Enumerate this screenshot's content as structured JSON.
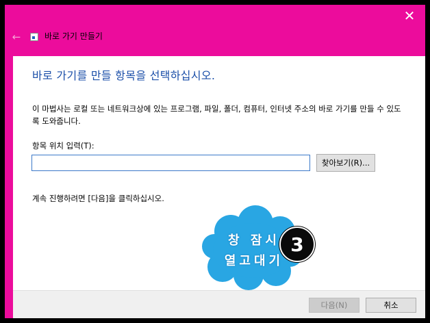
{
  "window": {
    "title": "바로 가기 만들기",
    "accent_color": "#ec0c9c",
    "close_glyph": "✕",
    "back_glyph": "←",
    "icons": {
      "close": "close-icon",
      "back": "back-arrow-icon",
      "app": "shortcut-icon"
    }
  },
  "wizard": {
    "heading": "바로 가기를 만들 항목을 선택하십시오.",
    "description": "이 마법사는 로컬 또는 네트워크상에 있는 프로그램, 파일, 폴더, 컴퓨터, 인터넷 주소의 바로 가기를 만들 수 있도록 도와줍니다.",
    "location_label": "항목 위치 입력(T):",
    "location_value": "",
    "browse_label": "찾아보기(R)...",
    "continue_text": "계속 진행하려면 [다음]을 클릭하십시오."
  },
  "footer": {
    "next_label": "다음(N)",
    "cancel_label": "취소"
  },
  "annotation": {
    "cloud_line1": "창 잠시",
    "cloud_line2": "열고대기",
    "step_number": "3",
    "cloud_color": "#29a6e3"
  }
}
